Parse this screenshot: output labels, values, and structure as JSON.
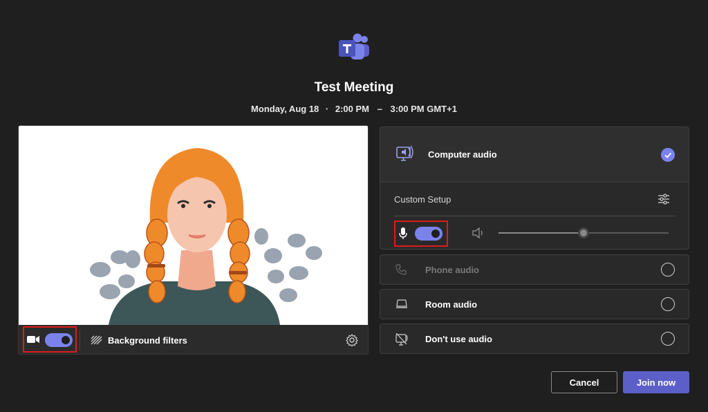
{
  "meeting": {
    "title": "Test Meeting",
    "date": "Monday, Aug 18",
    "separator": "·",
    "start_time": "2:00 PM",
    "dash": "–",
    "end_time": "3:00 PM GMT+1"
  },
  "video": {
    "camera_on": true,
    "background_filters_label": "Background filters"
  },
  "audio": {
    "selected": "Computer audio",
    "computer_audio_label": "Computer audio",
    "custom_setup_label": "Custom Setup",
    "mic_on": true,
    "speaker_volume": 0.5,
    "options": [
      {
        "label": "Phone audio",
        "enabled": false
      },
      {
        "label": "Room audio",
        "enabled": true
      },
      {
        "label": "Don't use audio",
        "enabled": true
      }
    ]
  },
  "actions": {
    "cancel_label": "Cancel",
    "join_label": "Join now"
  },
  "colors": {
    "accent": "#7b83eb",
    "join_button": "#5b5fc7",
    "highlight": "#e01b1b",
    "background": "#1f1f1f"
  }
}
